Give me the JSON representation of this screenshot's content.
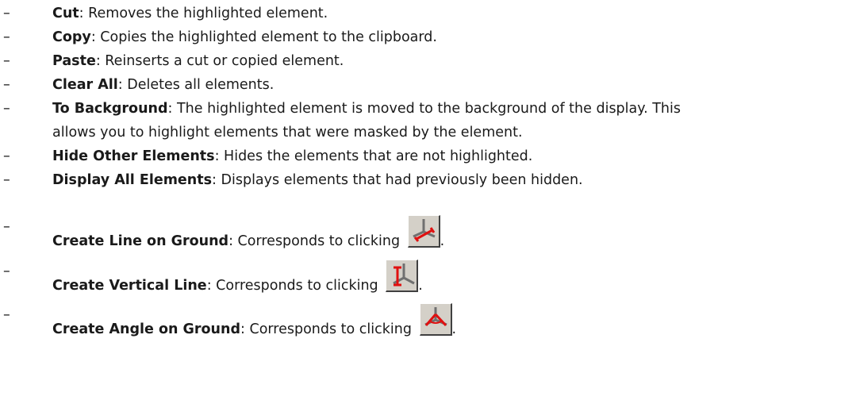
{
  "bullet": "–",
  "items": [
    {
      "term": "Cut",
      "desc": ": Removes the highlighted element."
    },
    {
      "term": "Copy",
      "desc": ": Copies the highlighted element to the clipboard."
    },
    {
      "term": "Paste",
      "desc": ": Reinserts a cut or copied element."
    },
    {
      "term": "Clear All",
      "desc": ": Deletes all elements."
    },
    {
      "term": "To Background",
      "desc": ": The highlighted element is moved to the background of the display. This",
      "desc2": "allows you to highlight elements that were masked by the element."
    },
    {
      "term": "Hide Other Elements",
      "desc": ": Hides the elements that are not highlighted."
    },
    {
      "term": "Display All Elements",
      "desc": ": Displays elements that had previously been hidden."
    },
    {
      "term": "Create Line on Ground",
      "desc": ": Corresponds to clicking ",
      "icon": "create-line-on-ground-icon",
      "after": "."
    },
    {
      "term": "Create Vertical Line",
      "desc": ": Corresponds to clicking ",
      "icon": "create-vertical-line-icon",
      "after": "."
    },
    {
      "term": "Create Angle on Ground",
      "desc": ": Corresponds to clicking ",
      "icon": "create-angle-on-ground-icon",
      "after": "."
    }
  ],
  "colors": {
    "text": "#1a1a1a",
    "icon_face": "#d4d0c8",
    "icon_red": "#e01010",
    "icon_axis": "#707070"
  }
}
